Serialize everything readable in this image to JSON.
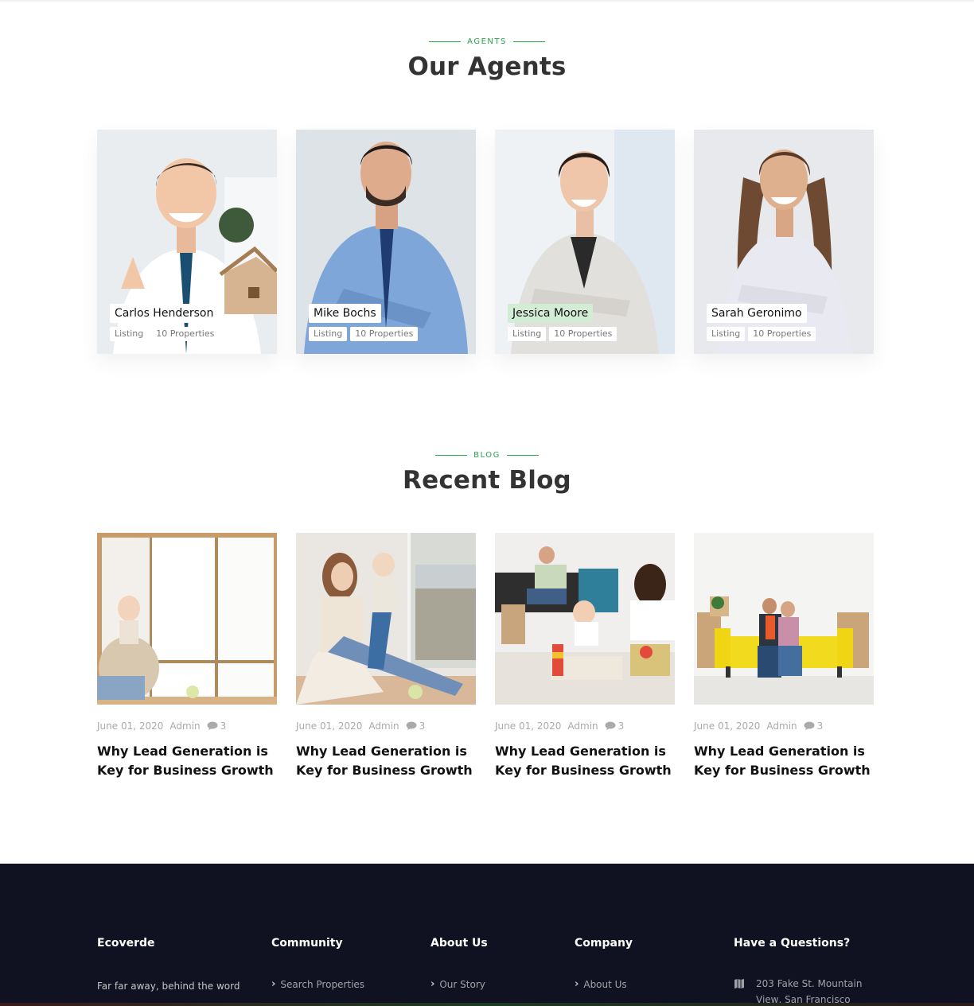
{
  "agents_section": {
    "eyebrow": "AGENTS",
    "title": "Our Agents"
  },
  "agents": [
    {
      "name": "Carlos Henderson",
      "tag1": "Listing",
      "tag2": "10 Properties",
      "highlight": false
    },
    {
      "name": "Mike Bochs",
      "tag1": "Listing",
      "tag2": "10 Properties",
      "highlight": false
    },
    {
      "name": "Jessica Moore",
      "tag1": "Listing",
      "tag2": "10 Properties",
      "highlight": true
    },
    {
      "name": "Sarah Geronimo",
      "tag1": "Listing",
      "tag2": "10 Properties",
      "highlight": false
    }
  ],
  "blog_section": {
    "eyebrow": "BLOG",
    "title": "Recent Blog"
  },
  "blogs": [
    {
      "date": "June 01, 2020",
      "author": "Admin",
      "comments": "3",
      "title": "Why Lead Generation is Key for Business Growth"
    },
    {
      "date": "June 01, 2020",
      "author": "Admin",
      "comments": "3",
      "title": "Why Lead Generation is Key for Business Growth"
    },
    {
      "date": "June 01, 2020",
      "author": "Admin",
      "comments": "3",
      "title": "Why Lead Generation is Key for Business Growth"
    },
    {
      "date": "June 01, 2020",
      "author": "Admin",
      "comments": "3",
      "title": "Why Lead Generation is Key for Business Growth"
    }
  ],
  "footer": {
    "brand": {
      "title": "Ecoverde",
      "text": "Far far away, behind the word"
    },
    "community": {
      "title": "Community",
      "link1": "Search Properties"
    },
    "about": {
      "title": "About Us",
      "link1": "Our Story"
    },
    "company": {
      "title": "Company",
      "link1": "About Us"
    },
    "contact": {
      "title": "Have a Questions?",
      "address": "203 Fake St. Mountain View, San Francisco"
    }
  },
  "colors": {
    "accent": "#2aa24a",
    "footer_bg": "#111221",
    "highlight": "#d3ecd6"
  },
  "icons": [
    "comment-icon",
    "chevron-right-icon",
    "map-icon"
  ]
}
